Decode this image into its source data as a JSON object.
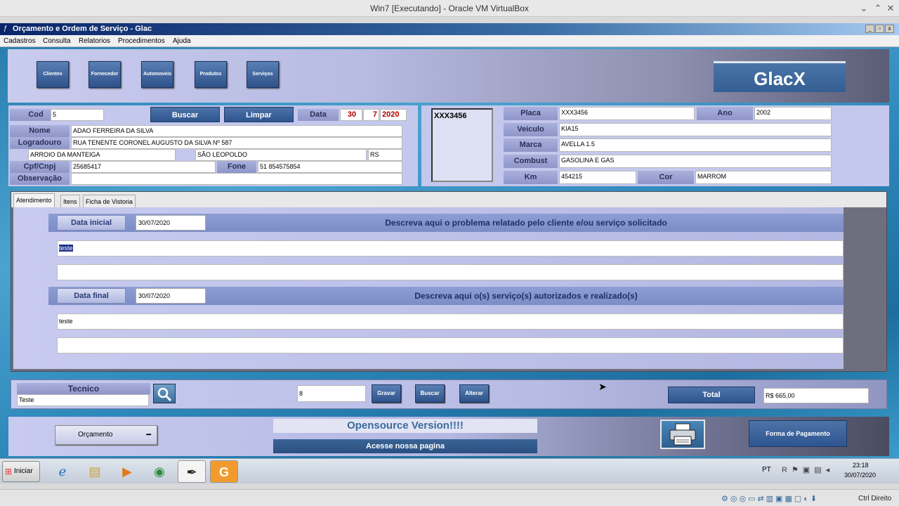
{
  "host": {
    "title": "Win7 [Executando] - Oracle VM VirtualBox",
    "status_right": "Ctrl Direito"
  },
  "app": {
    "title": "Orçamento e Ordem de Serviço - Glac",
    "menu": [
      "Cadastros",
      "Consulta",
      "Relatorios",
      "Procedimentos",
      "Ajuda"
    ],
    "nav_buttons": [
      "Clientes",
      "Fornecedor",
      "Automoveis",
      "Produtos",
      "Serviços"
    ],
    "brand": "GlacX"
  },
  "client": {
    "cod_label": "Cod",
    "cod_value": "5",
    "buscar_label": "Buscar",
    "limpar_label": "Limpar",
    "data_label": "Data",
    "data_day": "30",
    "data_month": "7",
    "data_year": "2020",
    "nome_label": "Nome",
    "nome_value": "ADAO FERREIRA DA SILVA",
    "logradouro_label": "Logradouro",
    "logradouro_value": "RUA TENENTE CORONEL AUGUSTO DA SILVA Nº 587",
    "bairro_value": "ARROIO DA MANTEIGA",
    "cidade_value": "SÃO LEOPOLDO",
    "uf_value": "RS",
    "cpf_label": "Cpf/Cnpj",
    "cpf_value": "25685417",
    "fone_label": "Fone",
    "fone_value": "51 854575854",
    "obs_label": "Observação",
    "obs_value": ""
  },
  "vehicle": {
    "list_item": "XXX3456",
    "placa_label": "Placa",
    "placa_value": "XXX3456",
    "ano_label": "Ano",
    "ano_value": "2002",
    "veiculo_label": "Veiculo",
    "veiculo_value": "KIA15",
    "marca_label": "Marca",
    "marca_value": "AVELLA 1.5",
    "combust_label": "Combust",
    "combust_value": "GASOLINA E GAS",
    "km_label": "Km",
    "km_value": "454215",
    "cor_label": "Cor",
    "cor_value": "MARROM"
  },
  "tabs": [
    "Atendimento",
    "Itens",
    "Ficha de Vistoria"
  ],
  "atendimento": {
    "data_inicial_label": "Data inicial",
    "data_inicial_value": "30/07/2020",
    "problema_title": "Descreva aqui o problema relatado pelo cliente e/ou serviço solicitado",
    "problema_line1": "teste",
    "problema_line2": "",
    "data_final_label": "Data final",
    "data_final_value": "30/07/2020",
    "servicos_title": "Descreva aqui o(s) serviço(s) autorizados e realizado(s)",
    "servicos_line1": "teste",
    "servicos_line2": ""
  },
  "tecnico": {
    "label": "Tecnico",
    "value": "Teste",
    "numero_value": "8",
    "btn_gravar": "Gravar",
    "btn_buscar": "Buscar",
    "btn_alterar": "Alterar",
    "total_label": "Total",
    "total_value": "R$ 665,00"
  },
  "footer": {
    "tipo_select": "Orçamento",
    "opensource": "Opensource Version!!!!",
    "pagina": "Acesse nossa pagina",
    "forma_pagamento": "Forma de Pagamento"
  },
  "taskbar": {
    "start": "Iniciar",
    "lang": "PT",
    "time": "23:18",
    "date": "30/07/2020"
  },
  "colors": {
    "accent_blue": "#2f5590",
    "panel": "#c4c8ec",
    "red_text": "#b00000"
  }
}
